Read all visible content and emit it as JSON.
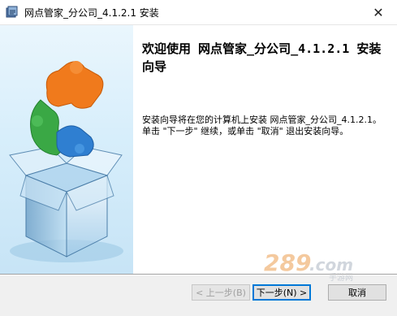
{
  "window": {
    "title": "网点管家_分公司_4.1.2.1 安装",
    "close_symbol": "✕"
  },
  "content": {
    "welcome_title": "欢迎使用 网点管家_分公司_4.1.2.1 安装向导",
    "description": "安装向导将在您的计算机上安装 网点管家_分公司_4.1.2.1。单击 \"下一步\" 继续，或单击 \"取消\" 退出安装向导。"
  },
  "watermark": {
    "text": "289.com",
    "subtext": "手游网"
  },
  "buttons": {
    "back": "< 上一步(B)",
    "next": "下一步(N) >",
    "cancel": "取消"
  },
  "colors": {
    "accent": "#0078d7",
    "puzzle_orange": "#f07a1c",
    "puzzle_green": "#3aa845",
    "puzzle_blue": "#2f7fd1"
  },
  "icons": {
    "app": "installer-app-icon",
    "close": "close-icon",
    "illustration": "puzzle-box-illustration"
  }
}
